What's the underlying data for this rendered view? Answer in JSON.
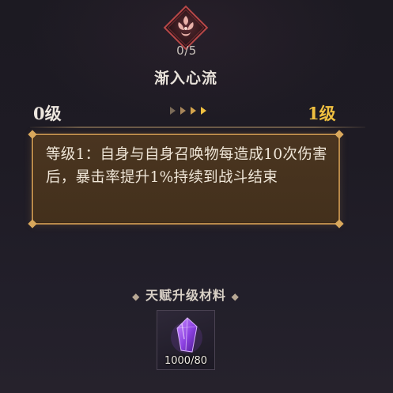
{
  "talent": {
    "name": "渐入心流",
    "points": "0/5",
    "icon": "talent-emblem-icon",
    "accent_color": "#b83a3a"
  },
  "levels": {
    "current": "0级",
    "next": "1级",
    "next_color": "#f0c040"
  },
  "description": {
    "text": "等级1：自身与自身召唤物每造成10次伤害后，暴击率提升1%持续到战斗结束",
    "border_color": "#b8894a"
  },
  "materials": {
    "header": "天赋升级材料",
    "items": [
      {
        "icon": "purple-crystal-icon",
        "count": "1000/80"
      }
    ]
  }
}
